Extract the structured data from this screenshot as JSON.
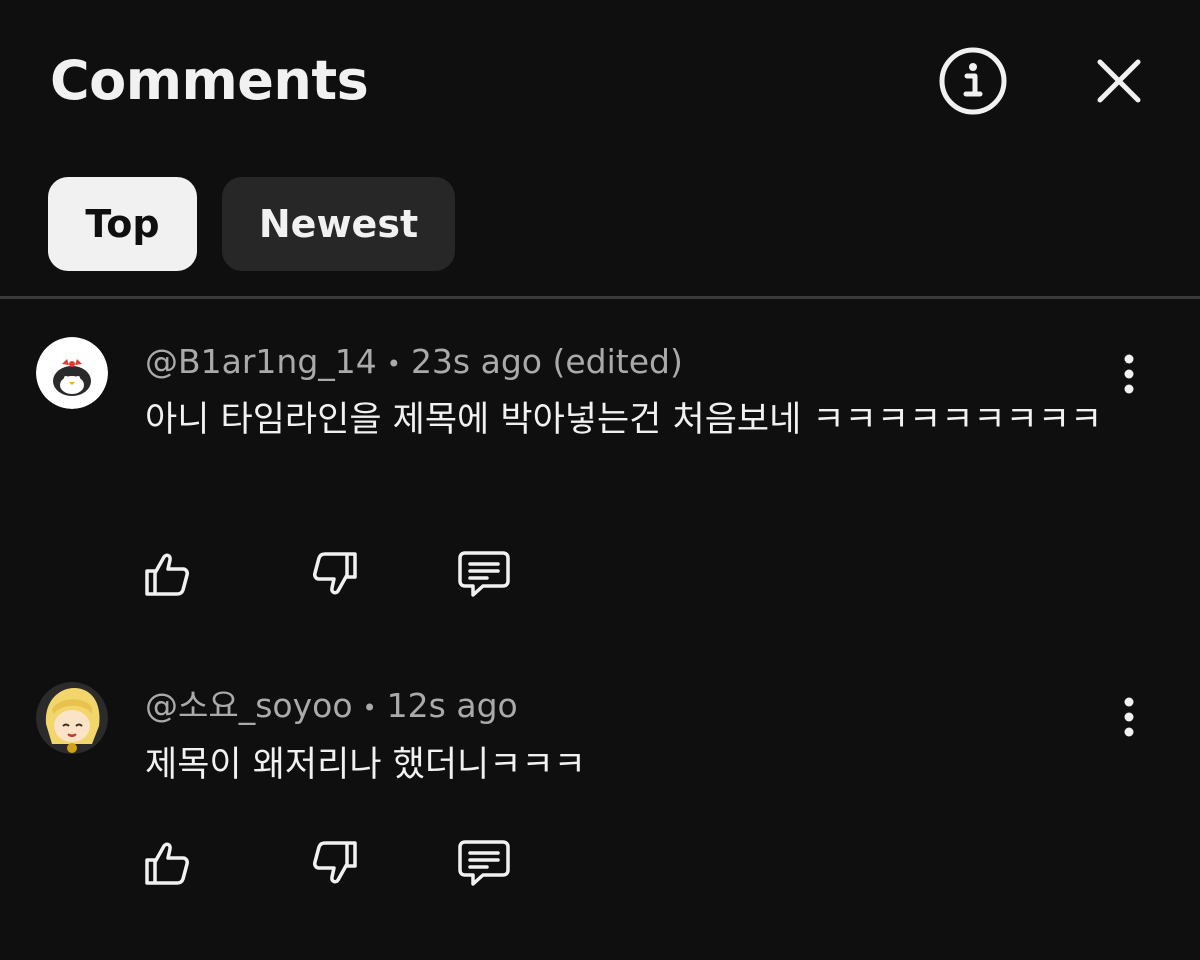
{
  "header": {
    "title": "Comments",
    "info_icon": "info-circle-icon",
    "close_icon": "close-icon"
  },
  "tabs": [
    {
      "label": "Top",
      "active": true
    },
    {
      "label": "Newest",
      "active": false
    }
  ],
  "comments": [
    {
      "handle": "@B1ar1ng_14",
      "separator": "•",
      "time": "23s ago (edited)",
      "text": "아니 타임라인을 제목에 박아넣는건 처음보네 ㅋㅋㅋㅋㅋㅋㅋㅋㅋ",
      "avatar": "penguin-avatar"
    },
    {
      "handle": "@소요_soyoo",
      "separator": "•",
      "time": "12s ago",
      "text": "제목이 왜저리나 했더니ㅋㅋㅋ",
      "avatar": "anime-character-avatar"
    }
  ],
  "colors": {
    "background": "#0f0f0f",
    "text_primary": "#f1f1f1",
    "text_secondary": "#aaaaaa",
    "chip_active_bg": "#f1f1f1",
    "chip_inactive_bg": "#272727",
    "divider": "#3a3a3a"
  }
}
